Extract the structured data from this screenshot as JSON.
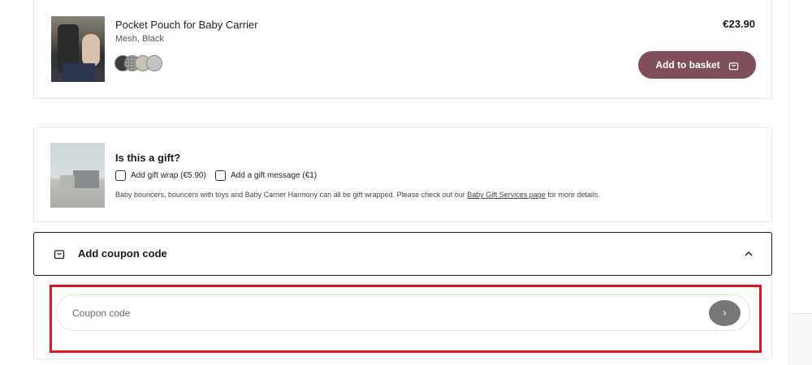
{
  "product": {
    "title": "Pocket Pouch for Baby Carrier",
    "variant": "Mesh, Black",
    "price": "€23.90",
    "add_to_basket_label": "Add to basket",
    "swatches": [
      "#3c3c3c",
      "#9a9a9a",
      "#c9c0b4",
      "#c4c4c4"
    ]
  },
  "gift": {
    "title": "Is this a gift?",
    "option_wrap_label": "Add gift wrap (€5.90)",
    "option_message_label": "Add a gift message (€1)",
    "note_text": "Baby bouncers, bouncers with toys and Baby Carrier Harmony can all be gift wrapped. Please check out our",
    "note_link": "Baby Gift Services page",
    "note_suffix": "for more details."
  },
  "coupon": {
    "header_label": "Add coupon code",
    "input_placeholder": "Coupon code",
    "input_value": "",
    "submit_icon": "›"
  },
  "colors": {
    "accent_button": "#7f4f5b",
    "highlight_border": "#e0141c",
    "submit_button": "#777777"
  }
}
